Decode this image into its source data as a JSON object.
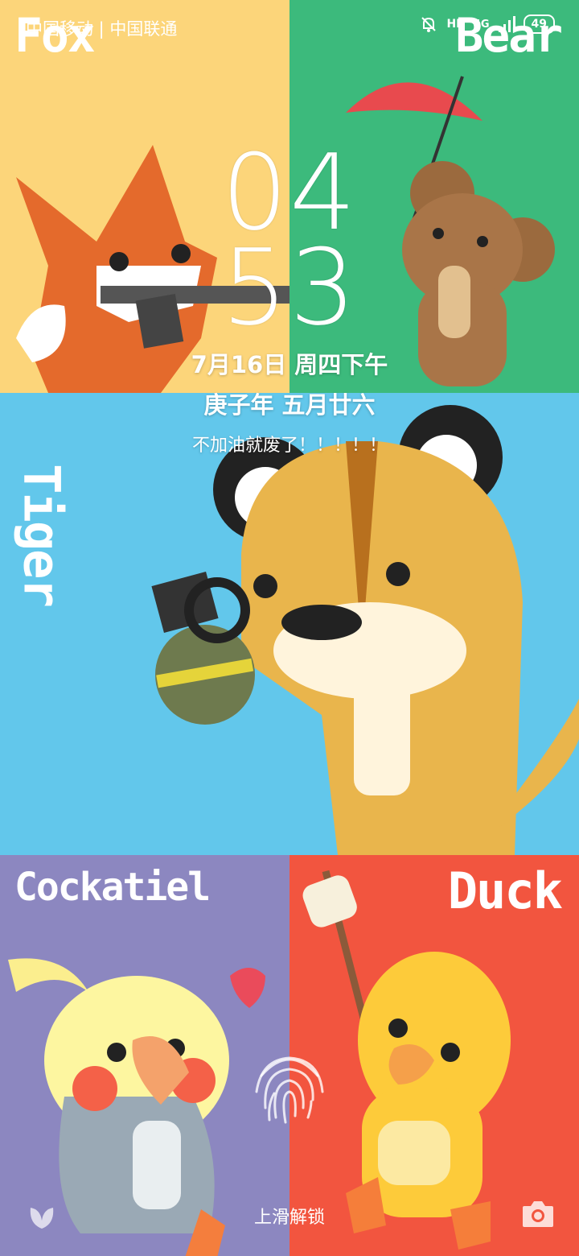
{
  "status_bar": {
    "carrier": "中国移动 | 中国联通",
    "network": "4G",
    "hd": "HD",
    "battery": "49"
  },
  "wallpaper": {
    "labels": {
      "fox": "Fox",
      "bear": "Bear",
      "tiger": "Tiger",
      "cockatiel": "Cockatiel",
      "duck": "Duck"
    },
    "colors": {
      "fox_bg": "#FCD57A",
      "bear_bg": "#3CBA7C",
      "tiger_bg": "#62C7EB",
      "cockatiel_bg": "#8C87C0",
      "duck_bg": "#F2553F"
    }
  },
  "clock": {
    "hour": "04",
    "minute": "53",
    "date": "7月16日 周四下午",
    "lunar": "庚子年 五月廿六",
    "motto": "不加油就废了！！！！！"
  },
  "lockscreen": {
    "unlock_hint": "上滑解锁"
  },
  "icons": {
    "left_shortcut": "leaf-icon",
    "right_shortcut": "camera-icon",
    "fingerprint": "fingerprint-icon"
  }
}
